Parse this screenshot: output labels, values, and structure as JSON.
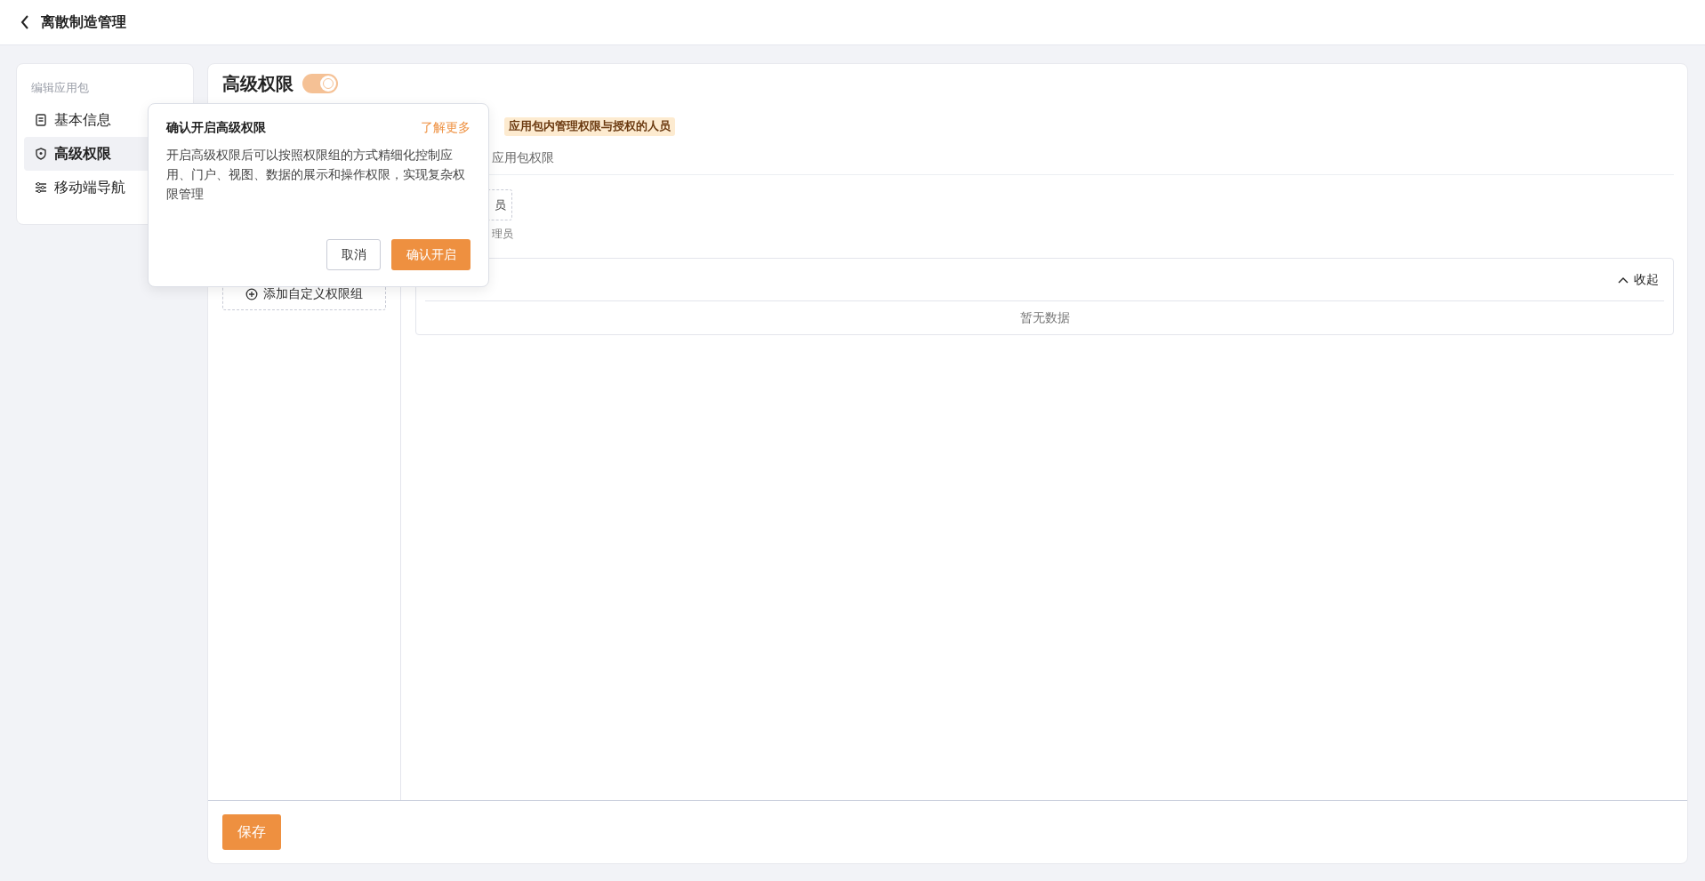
{
  "header": {
    "title": "离散制造管理"
  },
  "sidebar": {
    "heading": "编辑应用包",
    "items": [
      {
        "label": "基本信息",
        "kind": "document",
        "selected": false
      },
      {
        "label": "高级权限",
        "kind": "shield",
        "selected": true
      },
      {
        "label": "移动端导航",
        "kind": "sliders",
        "selected": false
      }
    ]
  },
  "main": {
    "title": "高级权限",
    "toggle": {
      "on": true
    },
    "tag": "应用包内管理权限与授权的人员",
    "subtitle": "应用包权限",
    "member_box": "员",
    "member_caption": "理员",
    "add_group": "添加自定义权限组",
    "collapse": "收起",
    "empty": "暂无数据"
  },
  "popover": {
    "title": "确认开启高级权限",
    "link": "了解更多",
    "body": "开启高级权限后可以按照权限组的方式精细化控制应用、门户、视图、数据的展示和操作权限，实现复杂权限管理",
    "buttons": [
      {
        "label": "取消",
        "kind": "secondary"
      },
      {
        "label": "确认开启",
        "kind": "primary"
      }
    ]
  },
  "footer": {
    "save": "保存"
  }
}
